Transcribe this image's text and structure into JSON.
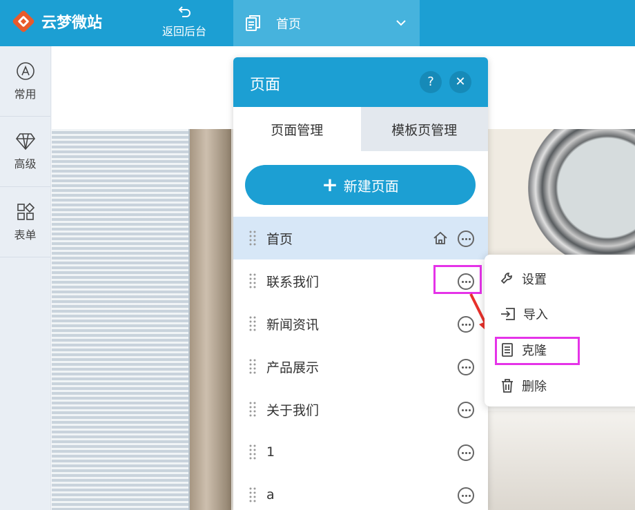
{
  "topbar": {
    "logo_text": "云梦微站",
    "back_label": "返回后台",
    "current_page": "首页"
  },
  "sidebar": {
    "items": [
      {
        "label": "常用",
        "icon": "letter-a-circle-icon"
      },
      {
        "label": "高级",
        "icon": "diamond-icon"
      },
      {
        "label": "表单",
        "icon": "shapes-grid-icon"
      }
    ]
  },
  "panel": {
    "title": "页面",
    "help_label": "?",
    "close_label": "✕",
    "tabs": [
      {
        "label": "页面管理",
        "active": true
      },
      {
        "label": "模板页管理",
        "active": false
      }
    ],
    "new_page_label": "新建页面",
    "pages": [
      {
        "name": "首页",
        "selected": true,
        "is_home": true
      },
      {
        "name": "联系我们",
        "selected": false,
        "is_home": false
      },
      {
        "name": "新闻资讯",
        "selected": false,
        "is_home": false
      },
      {
        "name": "产品展示",
        "selected": false,
        "is_home": false
      },
      {
        "name": "关于我们",
        "selected": false,
        "is_home": false
      },
      {
        "name": "1",
        "selected": false,
        "is_home": false
      },
      {
        "name": "a",
        "selected": false,
        "is_home": false
      }
    ]
  },
  "context_menu": {
    "items": [
      {
        "label": "设置",
        "icon": "wrench-icon"
      },
      {
        "label": "导入",
        "icon": "import-icon"
      },
      {
        "label": "克隆",
        "icon": "document-icon"
      },
      {
        "label": "删除",
        "icon": "trash-icon"
      }
    ]
  },
  "colors": {
    "brand_blue": "#1c9fd3",
    "highlight_magenta": "#e533e8",
    "arrow_red": "#e8312b",
    "logo_orange": "#e85a2c"
  }
}
